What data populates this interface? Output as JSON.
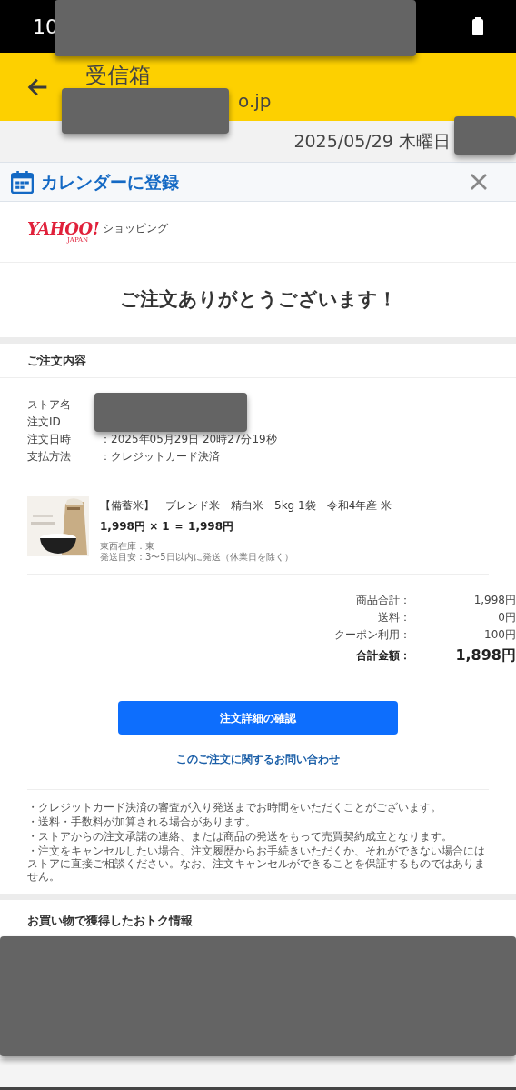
{
  "status_bar": {
    "time": "10"
  },
  "header": {
    "title": "受信箱",
    "sender": "o.jp"
  },
  "date": "2025/05/29 木曜日",
  "calendar_bar": {
    "label": "カレンダーに登録"
  },
  "shop_logo": {
    "brand": "YAHOO!",
    "sub": "JAPAN",
    "service": "ショッピング"
  },
  "thanks": "ご注文ありがとうございます！",
  "order": {
    "heading": "ご注文内容",
    "fields": [
      {
        "label": "ストア名"
      },
      {
        "label": "注文ID"
      },
      {
        "label": "注文日時",
        "value": "：2025年05月29日 20時27分19秒"
      },
      {
        "label": "支払方法",
        "value": "：クレジットカード決済"
      }
    ],
    "item": {
      "name": "【備蓄米】　ブレンド米　精白米　5kg 1袋　令和4年産 米",
      "price": "1,998円 × 1 ＝ 1,998円",
      "stock": "東西在庫：東",
      "shipping": "発送目安：3〜5日以内に発送（休業日を除く）"
    },
    "totals": [
      {
        "label": "商品合計：",
        "value": "1,998円",
        "kind": "normal"
      },
      {
        "label": "送料：",
        "value": "0円",
        "kind": "normal"
      },
      {
        "label": "クーポン利用：",
        "value": "-100円",
        "kind": "normal"
      },
      {
        "label": "合計金額：",
        "value": "1,898円",
        "kind": "grand"
      }
    ],
    "primary_button": "注文詳細の確認",
    "contact_link": "このご注文に関するお問い合わせ",
    "notes": [
      "・クレジットカード決済の審査が入り発送までお時間をいただくことがございます。",
      "・送料・手数料が加算される場合があります。",
      "・ストアからの注文承諾の連絡、または商品の発送をもって売買契約成立となります。",
      "・注文をキャンセルしたい場合、注文履歴からお手続きいただくか、それができない場合にはストアに直接ご相談ください。なお、注文キャンセルができることを保証するものではありません。"
    ]
  },
  "benefits": {
    "heading": "お買い物で獲得したおトク情報"
  }
}
